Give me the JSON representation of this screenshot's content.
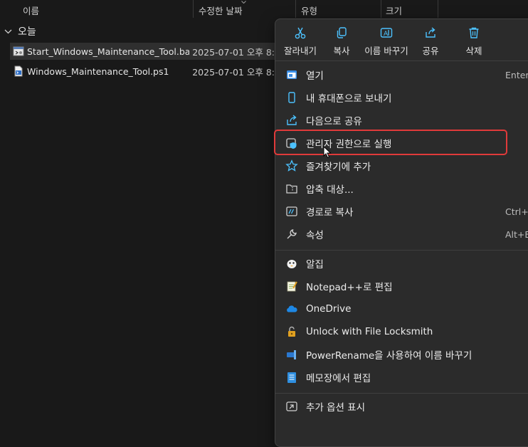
{
  "columns": {
    "name": "이름",
    "modified": "수정한 날짜",
    "type": "유형",
    "size": "크기"
  },
  "group": {
    "label": "오늘"
  },
  "files": [
    {
      "name": "Start_Windows_Maintenance_Tool.bat",
      "date": "2025-07-01 오후 8:",
      "selected": true
    },
    {
      "name": "Windows_Maintenance_Tool.ps1",
      "date": "2025-07-01 오후 8:",
      "selected": false
    }
  ],
  "quick_actions": [
    {
      "label": "잘라내기",
      "icon": "cut-icon"
    },
    {
      "label": "복사",
      "icon": "copy-icon"
    },
    {
      "label": "이름 바꾸기",
      "icon": "rename-icon"
    },
    {
      "label": "공유",
      "icon": "share-icon"
    },
    {
      "label": "삭제",
      "icon": "delete-icon"
    }
  ],
  "menu_items": [
    {
      "label": "열기",
      "shortcut": "Enter",
      "icon": "open-icon"
    },
    {
      "label": "내 휴대폰으로 보내기",
      "shortcut": "",
      "icon": "phone-icon"
    },
    {
      "label": "다음으로 공유",
      "shortcut": "",
      "icon": "share-with-icon"
    },
    {
      "label": "관리자 권한으로 실행",
      "shortcut": "",
      "icon": "run-as-admin-shield-icon"
    },
    {
      "label": "즐겨찾기에 추가",
      "shortcut": "",
      "icon": "star-icon"
    },
    {
      "label": "압축 대상...",
      "shortcut": "",
      "icon": "compress-icon"
    },
    {
      "label": "경로로 복사",
      "shortcut": "Ctrl+S",
      "icon": "copy-path-icon"
    },
    {
      "label": "속성",
      "shortcut": "Alt+En",
      "icon": "properties-wrench-icon"
    },
    {
      "label": "알집",
      "shortcut": "",
      "icon": "alzip-icon"
    },
    {
      "label": "Notepad++로 편집",
      "shortcut": "",
      "icon": "notepadpp-icon"
    },
    {
      "label": "OneDrive",
      "shortcut": "",
      "icon": "onedrive-cloud-icon"
    },
    {
      "label": "Unlock with File Locksmith",
      "shortcut": "",
      "icon": "lock-icon"
    },
    {
      "label": "PowerRename을 사용하여 이름 바꾸기",
      "shortcut": "",
      "icon": "powerrename-icon"
    },
    {
      "label": "메모장에서 편집",
      "shortcut": "",
      "icon": "notepad-icon"
    },
    {
      "label": "추가 옵션 표시",
      "shortcut": "",
      "icon": "more-options-icon"
    }
  ],
  "colors": {
    "accent": "#4cc2ff",
    "highlight_border": "#e03a3a",
    "menu_bg": "#2b2b2b",
    "window_bg": "#191919"
  }
}
